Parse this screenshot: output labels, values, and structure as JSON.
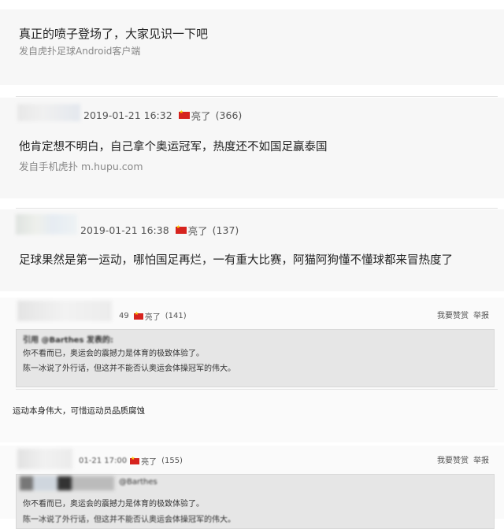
{
  "post1": {
    "text": "真正的喷子登场了，大家见识一下吧",
    "source": "发自虎扑足球Android客户端"
  },
  "reply2": {
    "time": "2019-01-21 16:32",
    "user": "亮了",
    "count": "(366)",
    "text": "他肯定想不明白，自己拿个奥运冠军，热度还不如国足赢泰国",
    "source": "发自手机虎扑 m.hupu.com"
  },
  "reply3": {
    "time": "2019-01-21 16:38",
    "user": "亮了",
    "count": "(137)",
    "text": "足球果然是第一运动，哪怕国足再烂，一有重大比赛，阿猫阿狗懂不懂球都来冒热度了"
  },
  "reply4": {
    "time_fragment": "49",
    "user": "亮了",
    "count": "(141)",
    "recommend": "我要赞赏",
    "report": "举报",
    "quote_header": "引用 @Barthes 发表的:",
    "quote_line1": "你不看而已，奥运会的震撼力是体育的极致体验了。",
    "quote_line2": "陈一冰说了外行话，但这并不能否认奥运会体操冠军的伟大。",
    "text": "运动本身伟大，可惜运动员品质腐蚀"
  },
  "reply5": {
    "time_fragment": "01-21 17:00",
    "user": "亮了",
    "count": "(155)",
    "recommend": "我要赞赏",
    "report": "举报",
    "quote_header": "@Barthes",
    "quote_line1": "你不看而已，奥运会的震撼力是体育的极致体验了。",
    "quote_line2": "陈一冰说了外行话，但这并不能否认奥运会体操冠军的伟大。"
  },
  "colors": {
    "flag": "#d6231e",
    "background": "#f7f7f7",
    "quote_bg": "#e6e6e6"
  }
}
